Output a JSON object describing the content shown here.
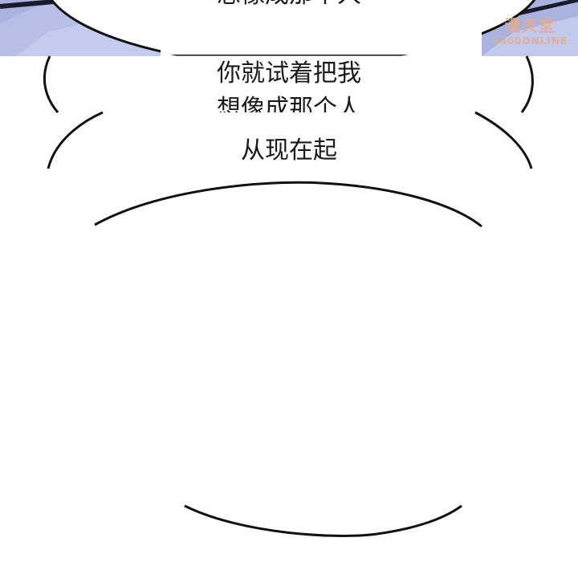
{
  "panel": {
    "top_line_partial": "想像成那个人",
    "line_1": "你就试着把我",
    "line_2_partial": "想像成那个人",
    "line_3": "从现在起"
  },
  "watermark": {
    "brand": "漫天堂",
    "url": "1800ONLINE"
  },
  "colors": {
    "background": "#ffffff",
    "bubble_outline": "#111111",
    "sky_blue": "#9fa8d8",
    "watermark": "#e6aa8c"
  }
}
